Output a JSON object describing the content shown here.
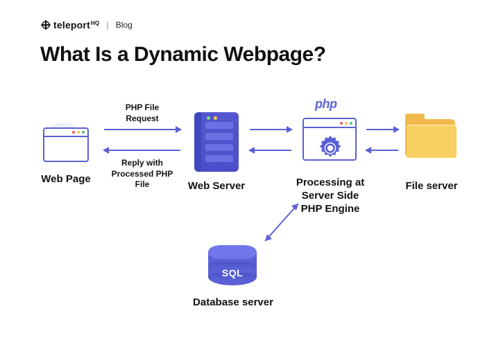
{
  "brand": {
    "name": "teleport",
    "suffix": "HQ",
    "section": "Blog"
  },
  "title": "What Is a Dynamic Webpage?",
  "nodes": {
    "webpage": {
      "label": "Web Page"
    },
    "webserver": {
      "label": "Web Server"
    },
    "phpproc": {
      "label": "Processing at Server Side PHP Engine",
      "logo": "php"
    },
    "fileserver": {
      "label": "File server"
    },
    "database": {
      "label": "Database server",
      "tech": "SQL"
    }
  },
  "arrows": {
    "webpage_to_server": "PHP File Request",
    "server_to_webpage": "Reply with Processed PHP File"
  },
  "colors": {
    "primary": "#5b60d6",
    "primary_light": "#7176ea",
    "folder": "#f8cf62",
    "folder_dark": "#f0b94b",
    "dot_red": "#e95b5b",
    "dot_yellow": "#f2c14e",
    "dot_green": "#56c271"
  }
}
